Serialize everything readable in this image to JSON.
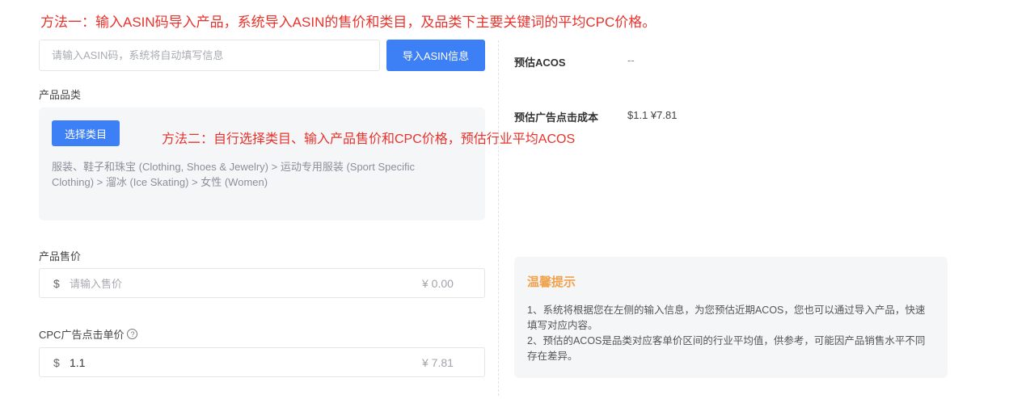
{
  "annotations": {
    "method_one": "方法一：输入ASIN码导入产品，系统导入ASIN的售价和类目，及品类下主要关键词的平均CPC价格。",
    "method_two": "方法二：自行选择类目、输入产品售价和CPC价格，预估行业平均ACOS"
  },
  "asin": {
    "placeholder": "请输入ASIN码，系统将自动填写信息",
    "import_label": "导入ASIN信息"
  },
  "category": {
    "label": "产品品类",
    "choose_label": "选择类目",
    "path": "服装、鞋子和珠宝 (Clothing, Shoes & Jewelry) > 运动专用服装 (Sport Specific Clothing) > 溜冰 (Ice Skating) > 女性 (Women)"
  },
  "price": {
    "label": "产品售价",
    "currency": "$",
    "placeholder": "请输入售价",
    "rmb": "¥ 0.00"
  },
  "cpc": {
    "label": "CPC广告点击单价",
    "help_icon": "?",
    "currency": "$",
    "value": "1.1",
    "rmb": "¥ 7.81"
  },
  "stats": {
    "acos_label": "预估ACOS",
    "acos_value": "--",
    "cost_label": "预估广告点击成本",
    "cost_value": "$1.1   ¥7.81"
  },
  "tips": {
    "title": "温馨提示",
    "line1": "1、系统将根据您在左侧的输入信息，为您预估近期ACOS，您也可以通过导入产品，快速填写对应内容。",
    "line2": "2、预估的ACOS是品类对应客单价区间的行业平均值，供参考，可能因产品销售水平不同存在差异。"
  },
  "colors": {
    "primary": "#3d7ff5",
    "annotation": "#e8322c",
    "tips_title": "#f0a24c"
  }
}
